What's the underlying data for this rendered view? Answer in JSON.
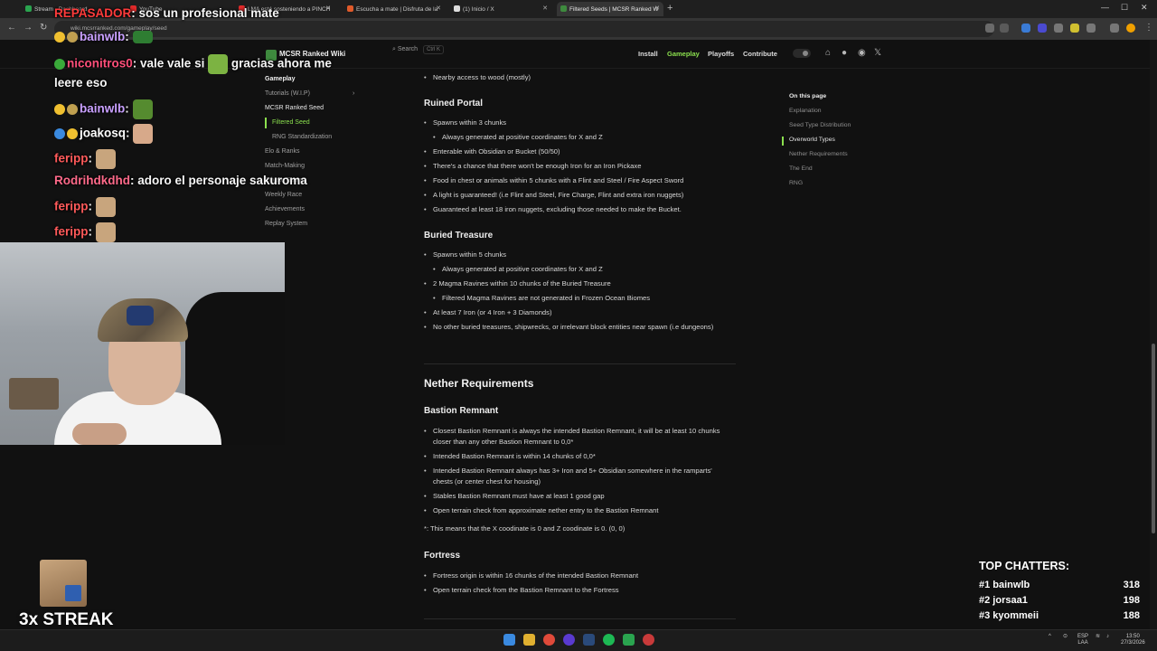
{
  "browser": {
    "tabs": [
      {
        "label": "Stream - Dashboard",
        "color": "#2aa44f"
      },
      {
        "label": "YouTube",
        "color": "#e02a2a"
      },
      {
        "label": "LMA está sosteniendo a PINCH",
        "color": "#e02a2a"
      },
      {
        "label": "Escucha a mate | Disfruta de la",
        "color": "#e05a2a"
      },
      {
        "label": "(1) Inicio / X",
        "color": "#dddddd"
      },
      {
        "label": "Filtered Seeds | MCSR Ranked W",
        "color": "#3e8a3e"
      }
    ],
    "url": "wiki.mcsrranked.com/gameplay/seed"
  },
  "site": {
    "logo": "MCSR Ranked Wiki",
    "search_label": "Search",
    "search_kbd": "Ctrl K",
    "nav": [
      "Install",
      "Gameplay",
      "Playoffs",
      "Contribute"
    ]
  },
  "sidebar": {
    "section": "Gameplay",
    "items": [
      "Tutorials (W.I.P)",
      "MCSR Ranked Seed",
      "Filtered Seed",
      "RNG Standardization",
      "Elo & Ranks",
      "Match-Making",
      "Private Rooms",
      "Weekly Race",
      "Achievements",
      "Replay System"
    ]
  },
  "main": {
    "top_item": "Nearby access to wood (mostly)",
    "ruined_portal": {
      "title": "Ruined Portal",
      "items": [
        "Spawns within 3 chunks",
        "Always generated at positive coordinates for X and Z",
        "Enterable with Obsidian or Bucket (50/50)",
        "There's a chance that there won't be enough Iron for an Iron Pickaxe",
        "Food in chest or animals within 5 chunks with a Flint and Steel / Fire Aspect Sword",
        "A light is guaranteed! (i.e Flint and Steel, Fire Charge, Flint and extra iron nuggets)",
        "Guaranteed at least 18 iron nuggets, excluding those needed to make the Bucket."
      ]
    },
    "buried_treasure": {
      "title": "Buried Treasure",
      "items": [
        "Spawns within 5 chunks",
        "Always generated at positive coordinates for X and Z",
        "2 Magma Ravines within 10 chunks of the Buried Treasure",
        "Filtered Magma Ravines are not generated in Frozen Ocean Biomes",
        "At least 7 Iron (or 4 Iron + 3 Diamonds)",
        "No other buried treasures, shipwrecks, or irrelevant block entities near spawn (i.e dungeons)"
      ]
    },
    "nether_title": "Nether Requirements",
    "bastion": {
      "title": "Bastion Remnant",
      "items": [
        "Closest Bastion Remnant is always the intended Bastion Remnant, it will be at least 10 chunks closer than any other Bastion Remnant to 0,0*",
        "Intended Bastion Remnant is within 14 chunks of 0,0*",
        "Intended Bastion Remnant always has 3+ Iron and 5+ Obsidian somewhere in the ramparts' chests (or center chest for housing)",
        "Stables Bastion Remnant must have at least 1 good gap",
        "Open terrain check from approximate nether entry to the Bastion Remnant"
      ],
      "footnote": "*: This means that the X coodinate is 0 and Z coodinate is 0. (0, 0)"
    },
    "fortress": {
      "title": "Fortress",
      "items": [
        "Fortress origin is within 16 chunks of the intended Bastion Remnant",
        "Open terrain check from the Bastion Remnant to the Fortress"
      ]
    }
  },
  "toc": {
    "title": "On this page",
    "items": [
      "Explanation",
      "Seed Type Distribution",
      "Overworld Types",
      "Nether Requirements",
      "The End",
      "RNG"
    ]
  },
  "chat": [
    {
      "user": "REPASADOR",
      "color": "#ff3b3b",
      "msg": ": sos un profesional mate"
    },
    {
      "user": "bainwlb",
      "color": "#c9a0ff",
      "msg": ":"
    },
    {
      "user": "niconitros0",
      "color": "#ff4f7a",
      "msg": ": vale vale si",
      "msg2": "gracias ahora me",
      "msg3": "leere eso"
    },
    {
      "user": "bainwlb",
      "color": "#c9a0ff",
      "msg": ":"
    },
    {
      "user": "joakosq",
      "color": "#ffffff",
      "msg": ":"
    },
    {
      "user": "feripp",
      "color": "#ff5a5a",
      "msg": ":"
    },
    {
      "user": "Rodrihdkdhd",
      "color": "#ff6a8a",
      "msg": ": adoro el personaje sakuroma"
    },
    {
      "user": "feripp",
      "color": "#ff5a5a",
      "msg": ":"
    },
    {
      "user": "feripp",
      "color": "#ff5a5a",
      "msg": ":"
    }
  ],
  "streak": "3x STREAK",
  "top_chatters": {
    "title": "TOP CHATTERS:",
    "rows": [
      {
        "rank": "#1 bainwlb",
        "count": "318"
      },
      {
        "rank": "#2 jorsaa1",
        "count": "198"
      },
      {
        "rank": "#3 kyommeii",
        "count": "188"
      }
    ]
  },
  "tray": {
    "lang1": "ESP",
    "lang2": "LAA",
    "time": "13:50",
    "date": "27/3/2026"
  }
}
